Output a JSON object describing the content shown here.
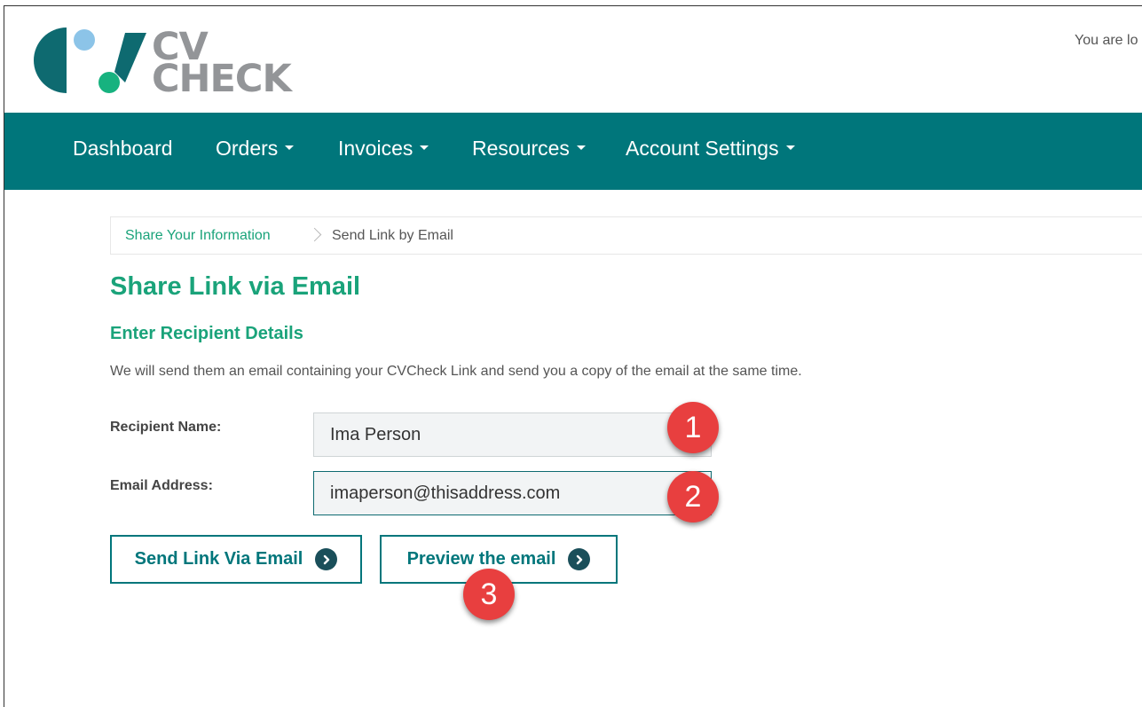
{
  "header": {
    "logo_text_line1": "CV",
    "logo_text_line2": "CHECK",
    "logged_in_text": "You are lo"
  },
  "nav": {
    "items": [
      {
        "label": "Dashboard",
        "dropdown": false
      },
      {
        "label": "Orders",
        "dropdown": true
      },
      {
        "label": "Invoices",
        "dropdown": true
      },
      {
        "label": "Resources",
        "dropdown": true
      },
      {
        "label": "Account Settings",
        "dropdown": true
      }
    ],
    "background_color": "#00767b"
  },
  "breadcrumb": {
    "link": "Share Your Information",
    "current": "Send Link by Email"
  },
  "main": {
    "title": "Share Link via Email",
    "section_title": "Enter Recipient Details",
    "intro": "We will send them an email containing your CVCheck Link and send you a copy of the email at the same time.",
    "form": {
      "recipient_name_label": "Recipient Name:",
      "recipient_name_value": "Ima Person",
      "email_label": "Email Address:",
      "email_value": "imaperson@thisaddress.com"
    },
    "buttons": {
      "send_label": "Send Link Via Email",
      "preview_label": "Preview the email"
    }
  },
  "annotations": {
    "badge_1": "1",
    "badge_2": "2",
    "badge_3": "3"
  },
  "colors": {
    "accent_green": "#1aa37a",
    "teal": "#00767b",
    "badge_red": "#e83f3f"
  }
}
